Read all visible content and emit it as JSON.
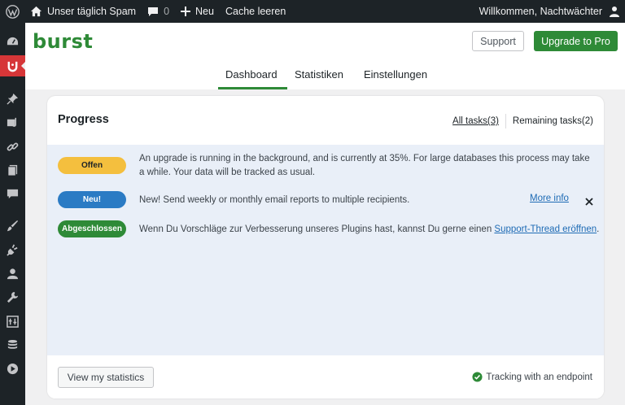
{
  "adminbar": {
    "site_name": "Unser täglich Spam",
    "comments_count": "0",
    "new_label": "Neu",
    "cache_label": "Cache leeren",
    "greeting": "Willkommen, Nachtwächter"
  },
  "sidebar": {
    "icons": [
      "dashboard-icon",
      "burst-icon",
      "pin-icon",
      "media-icon",
      "links-icon",
      "pages-icon",
      "comments-icon",
      "appearance-icon",
      "plugins-icon",
      "users-icon",
      "tools-icon",
      "settings-icon",
      "database-icon",
      "play-icon"
    ]
  },
  "header": {
    "logo": "burst",
    "support_label": "Support",
    "upgrade_label": "Upgrade to Pro",
    "tabs": [
      {
        "label": "Dashboard",
        "active": true
      },
      {
        "label": "Statistiken",
        "active": false
      },
      {
        "label": "Einstellungen",
        "active": false
      }
    ]
  },
  "progress": {
    "title": "Progress",
    "filter_all": "All tasks(3)",
    "filter_remaining": "Remaining tasks(2)",
    "tasks": [
      {
        "status": "Offen",
        "text": "An upgrade is running in the background, and is currently at 35%. For large databases this process may take a while. Your data will be tracked as usual."
      },
      {
        "status": "Neu!",
        "text": "New! Send weekly or monthly email reports to multiple recipients.",
        "link": "More info"
      },
      {
        "status": "Abgeschlossen",
        "text": "Wenn Du Vorschläge zur Verbesserung unseres Plugins hast, kannst Du gerne einen ",
        "link": "Support-Thread eröffnen",
        "suffix": "."
      }
    ],
    "view_stats_label": "View my statistics",
    "tracking_label": "Tracking with an endpoint"
  },
  "colors": {
    "brand": "#2e8a37",
    "adminbar": "#1d2327",
    "active_menu": "#d63638",
    "badge_open": "#f4bf3e",
    "badge_new": "#2b7bc4",
    "badge_done": "#2e8a37"
  }
}
